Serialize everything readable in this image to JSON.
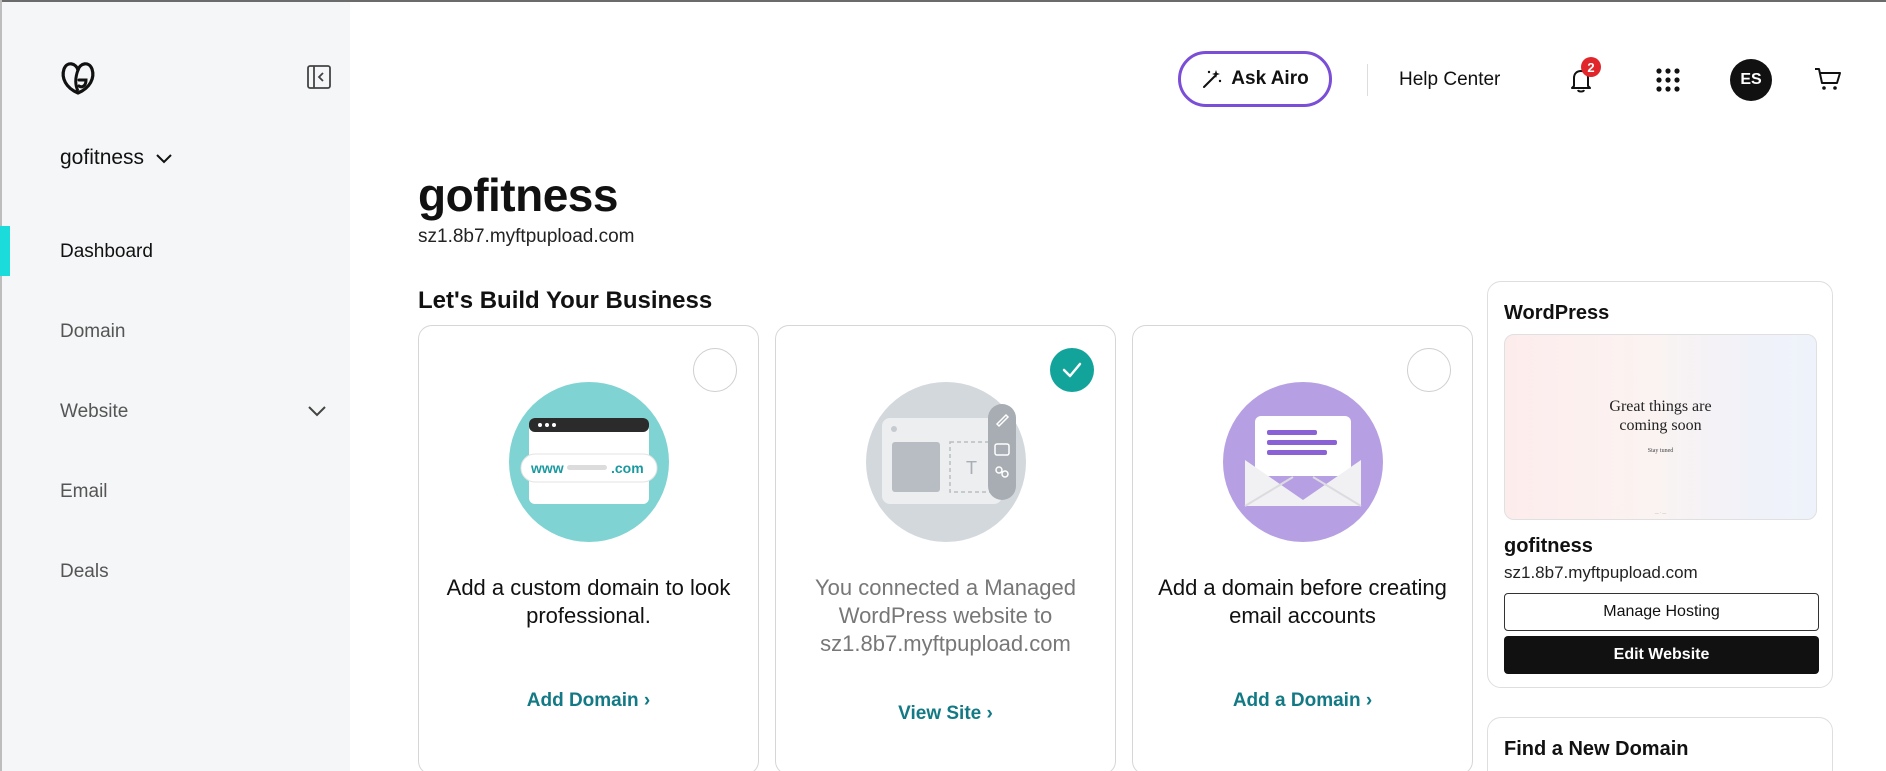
{
  "sidebar": {
    "site_name": "gofitness",
    "items": [
      {
        "label": "Dashboard"
      },
      {
        "label": "Domain"
      },
      {
        "label": "Website"
      },
      {
        "label": "Email"
      },
      {
        "label": "Deals"
      }
    ]
  },
  "header": {
    "ask_airo": "Ask Airo",
    "help_center": "Help Center",
    "notification_count": "2",
    "avatar_initials": "ES"
  },
  "main": {
    "title": "gofitness",
    "subtitle": "sz1.8b7.myftpupload.com",
    "section_title": "Let's Build Your Business",
    "cards": [
      {
        "text": "Add a custom domain to look professional.",
        "link": "Add Domain ›",
        "completed": false,
        "illustration_www": "www",
        "illustration_com": ".com"
      },
      {
        "text": "You connected a Managed WordPress website to sz1.8b7.myftpupload.com",
        "link": "View Site ›",
        "completed": true
      },
      {
        "text": "Add a domain before creating email accounts",
        "link": "Add a Domain ›",
        "completed": false
      }
    ]
  },
  "wordpress_panel": {
    "title": "WordPress",
    "preview_headline_line1": "Great things are",
    "preview_headline_line2": "coming soon",
    "preview_small": "Stay tuned",
    "site_name": "gofitness",
    "site_url": "sz1.8b7.myftpupload.com",
    "manage_label": "Manage Hosting",
    "edit_label": "Edit Website"
  },
  "domain_panel": {
    "title": "Find a New Domain"
  },
  "colors": {
    "accent_teal": "#137a85",
    "active_indicator": "#1bdbdb",
    "airo_purple": "#7a4ed6",
    "check_done": "#12a39b",
    "badge_red": "#e0262b"
  }
}
